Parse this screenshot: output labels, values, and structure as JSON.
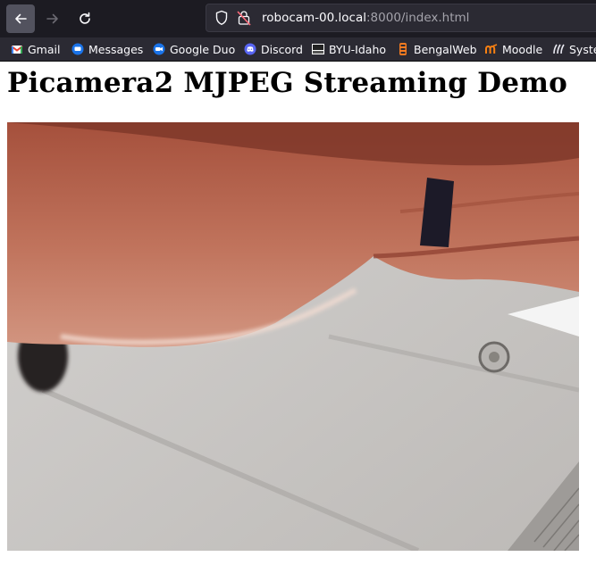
{
  "browser": {
    "url_host": "robocam-00.local",
    "url_rest": ":8000/index.html",
    "bookmarks": [
      {
        "label": "Gmail",
        "icon": "gmail-icon"
      },
      {
        "label": "Messages",
        "icon": "messages-icon"
      },
      {
        "label": "Google Duo",
        "icon": "google-duo-icon"
      },
      {
        "label": "Discord",
        "icon": "discord-icon"
      },
      {
        "label": "BYU-Idaho",
        "icon": "byu-idaho-icon"
      },
      {
        "label": "BengalWeb",
        "icon": "bengalweb-icon"
      },
      {
        "label": "Moodle",
        "icon": "moodle-icon"
      },
      {
        "label": "Syste",
        "icon": "system-icon"
      }
    ]
  },
  "page": {
    "title": "Picamera2 MJPEG Streaming Demo"
  },
  "stream": {
    "content": "mjpeg-camera-frame"
  }
}
